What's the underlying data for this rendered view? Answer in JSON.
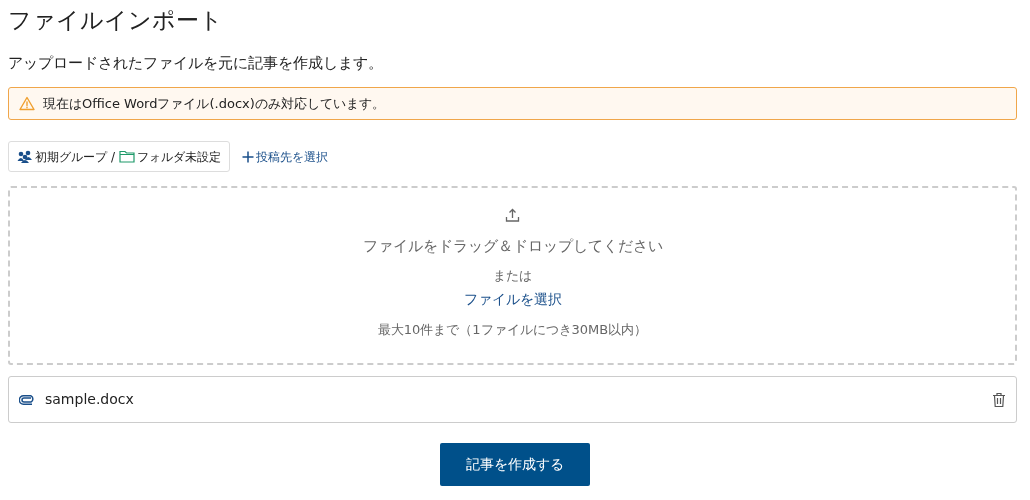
{
  "title": "ファイルインポート",
  "description": "アップロードされたファイルを元に記事を作成します。",
  "alert": {
    "text": "現在はOffice Wordファイル(.docx)のみ対応しています。"
  },
  "destination": {
    "group": "初期グループ",
    "separator": "/",
    "folder": "フォルダ未設定",
    "select_label": "投稿先を選択"
  },
  "dropzone": {
    "instruction": "ファイルをドラッグ＆ドロップしてください",
    "or": "または",
    "select_link": "ファイルを選択",
    "limit": "最大10件まで（1ファイルにつき30MB以内）"
  },
  "files": [
    {
      "name": "sample.docx"
    }
  ],
  "submit_button": "記事を作成する"
}
